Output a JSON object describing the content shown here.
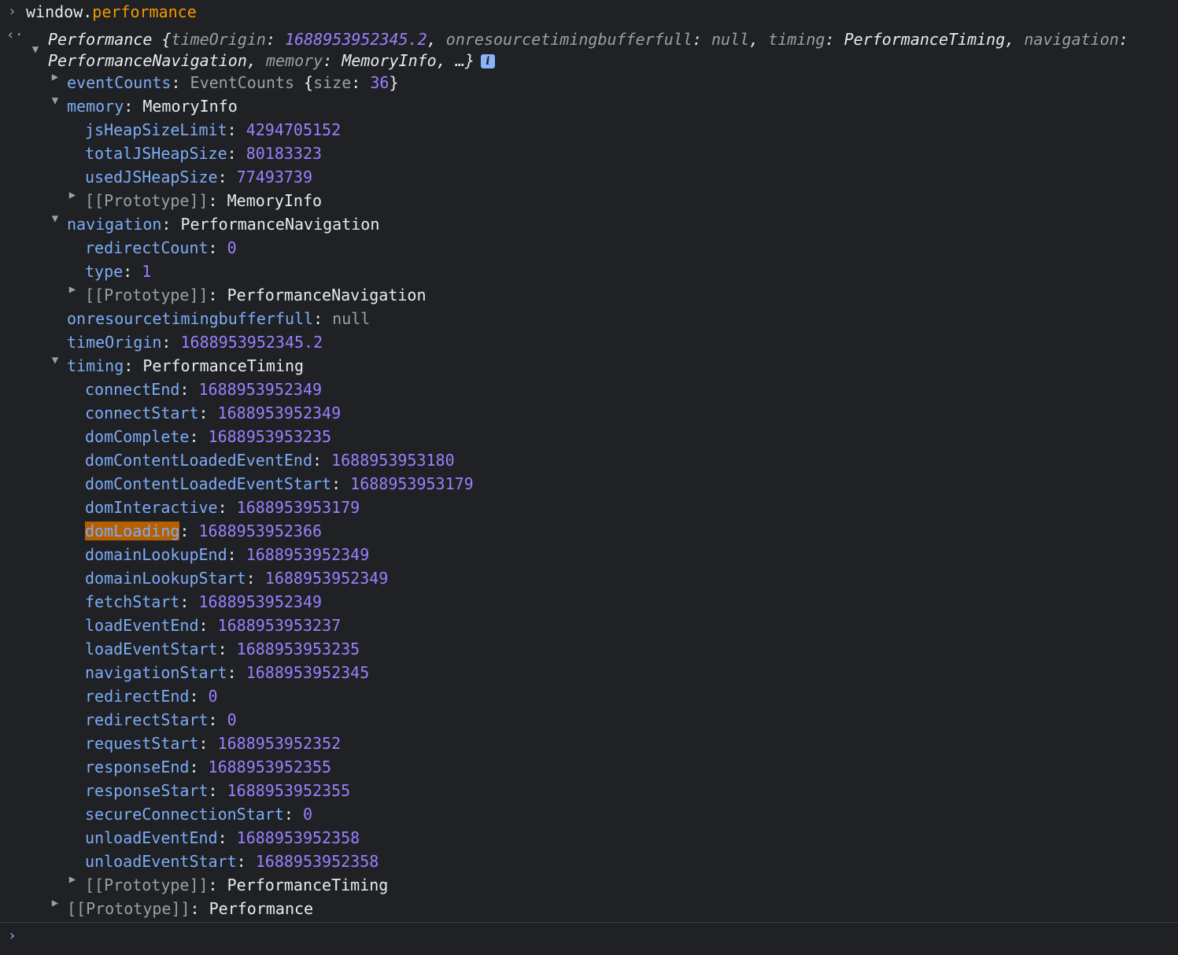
{
  "command": {
    "prefix": "window.",
    "property": "performance"
  },
  "summary": {
    "line1_pre": "Performance {",
    "timeOrigin_key": "timeOrigin",
    "timeOrigin_val": "1688953952345.2",
    "onres_key": "onresourcetimingbufferfull",
    "onres_val": "null",
    "timing_key": "timing",
    "timing_val": "PerformanceTiming",
    "navigation_key": "navigation",
    "line2_nav_val": "PerformanceNavigation",
    "memory_key": "memory",
    "memory_val": "MemoryInfo",
    "tail": ", …}",
    "info_icon": "i"
  },
  "tree": {
    "eventCounts": {
      "key": "eventCounts",
      "type": "EventCounts",
      "brace": "{",
      "size_key": "size",
      "size_val": "36",
      "close": "}"
    },
    "memory": {
      "key": "memory",
      "type": "MemoryInfo",
      "items": [
        {
          "key": "jsHeapSizeLimit",
          "val": "4294705152"
        },
        {
          "key": "totalJSHeapSize",
          "val": "80183323"
        },
        {
          "key": "usedJSHeapSize",
          "val": "77493739"
        }
      ],
      "proto": "MemoryInfo"
    },
    "navigation": {
      "key": "navigation",
      "type": "PerformanceNavigation",
      "items": [
        {
          "key": "redirectCount",
          "val": "0"
        },
        {
          "key": "type",
          "val": "1"
        }
      ],
      "proto": "PerformanceNavigation"
    },
    "onresourcetimingbufferfull": {
      "key": "onresourcetimingbufferfull",
      "val": "null"
    },
    "timeOrigin": {
      "key": "timeOrigin",
      "val": "1688953952345.2"
    },
    "timing": {
      "key": "timing",
      "type": "PerformanceTiming",
      "items": [
        {
          "key": "connectEnd",
          "val": "1688953952349"
        },
        {
          "key": "connectStart",
          "val": "1688953952349"
        },
        {
          "key": "domComplete",
          "val": "1688953953235"
        },
        {
          "key": "domContentLoadedEventEnd",
          "val": "1688953953180"
        },
        {
          "key": "domContentLoadedEventStart",
          "val": "1688953953179"
        },
        {
          "key": "domInteractive",
          "val": "1688953953179"
        },
        {
          "key": "domLoading",
          "val": "1688953952366"
        },
        {
          "key": "domainLookupEnd",
          "val": "1688953952349"
        },
        {
          "key": "domainLookupStart",
          "val": "1688953952349"
        },
        {
          "key": "fetchStart",
          "val": "1688953952349"
        },
        {
          "key": "loadEventEnd",
          "val": "1688953953237"
        },
        {
          "key": "loadEventStart",
          "val": "1688953953235"
        },
        {
          "key": "navigationStart",
          "val": "1688953952345"
        },
        {
          "key": "redirectEnd",
          "val": "0"
        },
        {
          "key": "redirectStart",
          "val": "0"
        },
        {
          "key": "requestStart",
          "val": "1688953952352"
        },
        {
          "key": "responseEnd",
          "val": "1688953952355"
        },
        {
          "key": "responseStart",
          "val": "1688953952355"
        },
        {
          "key": "secureConnectionStart",
          "val": "0"
        },
        {
          "key": "unloadEventEnd",
          "val": "1688953952358"
        },
        {
          "key": "unloadEventStart",
          "val": "1688953952358"
        }
      ],
      "proto": "PerformanceTiming"
    },
    "proto_label": "[[Prototype]]",
    "root_proto": "Performance",
    "highlighted_key": "domLoading"
  },
  "glyphs": {
    "prompt": "›",
    "result": "‹·",
    "expanded": "▼",
    "collapsed": "▶"
  }
}
